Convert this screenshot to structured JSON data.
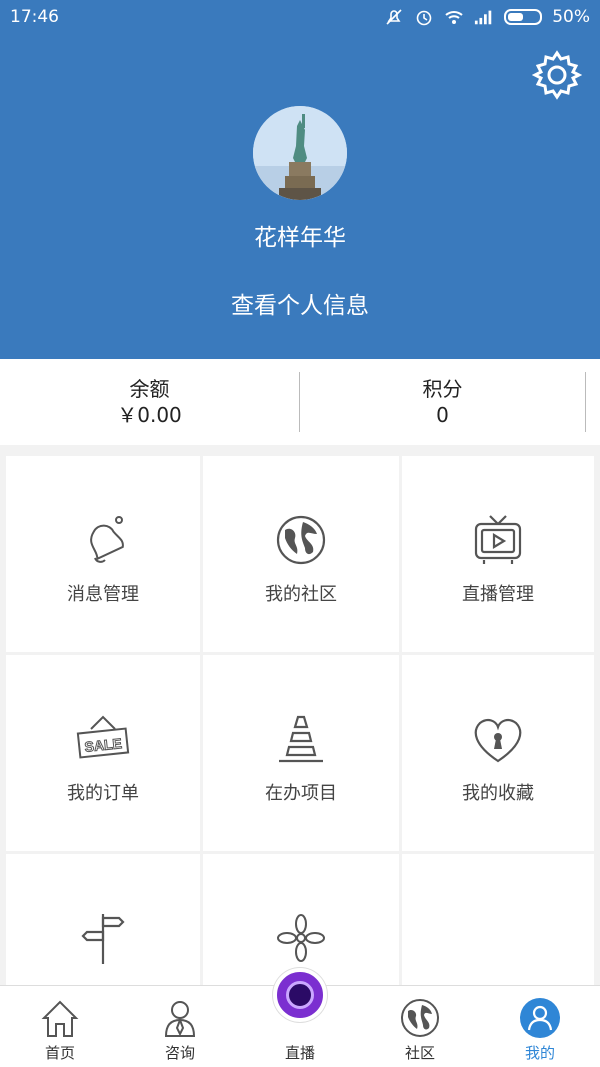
{
  "status_bar": {
    "time": "17:46",
    "battery": "50%",
    "battery_level": 0.5
  },
  "header": {
    "username": "花样年华",
    "view_profile": "查看个人信息",
    "settings_icon": "gear-icon",
    "bg_color": "#3a7abd"
  },
  "stats": {
    "balance_label": "余额",
    "balance_value": "￥0.00",
    "points_label": "积分",
    "points_value": "0"
  },
  "menu": [
    {
      "label": "消息管理",
      "icon": "bell-icon"
    },
    {
      "label": "我的社区",
      "icon": "globe-icon"
    },
    {
      "label": "直播管理",
      "icon": "tv-icon"
    },
    {
      "label": "我的订单",
      "icon": "sale-sign-icon"
    },
    {
      "label": "在办项目",
      "icon": "traffic-cone-icon"
    },
    {
      "label": "我的收藏",
      "icon": "heart-lock-icon"
    },
    {
      "label": "",
      "icon": "signpost-icon"
    },
    {
      "label": "",
      "icon": "flower-icon"
    },
    {
      "label": "",
      "icon": ""
    }
  ],
  "bottom_nav": [
    {
      "label": "首页",
      "icon": "home-icon",
      "active": false
    },
    {
      "label": "咨询",
      "icon": "person-icon",
      "active": false
    },
    {
      "label": "直播",
      "icon": "live-camera-icon",
      "active": false
    },
    {
      "label": "社区",
      "icon": "globe-icon",
      "active": false
    },
    {
      "label": "我的",
      "icon": "profile-icon",
      "active": true
    }
  ],
  "accent_color": "#2f86d6"
}
